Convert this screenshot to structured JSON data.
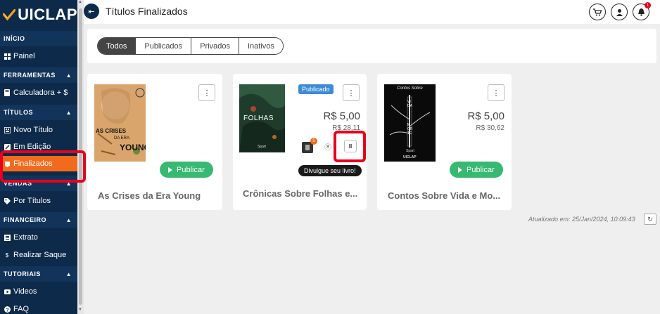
{
  "brand": {
    "name": "UICLAP",
    "colors": {
      "navy": "#0d2a4a",
      "orange": "#f26b1d",
      "green": "#38b972",
      "blue": "#3d8ad6"
    }
  },
  "sidebar": {
    "sections": [
      {
        "label": "INÍCIO",
        "items": [
          {
            "label": "Painel",
            "icon": "grid-icon"
          }
        ]
      },
      {
        "label": "FERRAMENTAS",
        "items": [
          {
            "label": "Calculadora + $",
            "icon": "calculator-icon"
          }
        ]
      },
      {
        "label": "TÍTULOS",
        "items": [
          {
            "label": "Novo Título",
            "icon": "new-doc-icon"
          },
          {
            "label": "Em Edição",
            "icon": "edit-icon"
          },
          {
            "label": "Finalizados",
            "icon": "done-icon",
            "active": true
          }
        ]
      },
      {
        "label": "VENDAS",
        "items": [
          {
            "label": "Por Títulos",
            "icon": "tag-icon"
          }
        ]
      },
      {
        "label": "FINANCEIRO",
        "items": [
          {
            "label": "Extrato",
            "icon": "statement-icon"
          },
          {
            "label": "Realizar Saque",
            "icon": "dollar-icon"
          }
        ]
      },
      {
        "label": "TUTORIAIS",
        "items": [
          {
            "label": "Videos",
            "icon": "video-icon"
          },
          {
            "label": "FAQ",
            "icon": "help-icon"
          }
        ]
      }
    ]
  },
  "header": {
    "title": "Títulos Finalizados",
    "notifications": "1"
  },
  "filters": {
    "tabs": [
      "Todos",
      "Publicados",
      "Privados",
      "Inativos"
    ],
    "active": "Todos"
  },
  "cards": [
    {
      "title": "As Crises da Era Young",
      "cover_text": [
        "AS CRISES",
        "DA ERA",
        "YOUNG"
      ],
      "publish_label": "Publicar"
    },
    {
      "title": "Crônicas Sobre Folhas e...",
      "cover_text": [
        "FOLHAS",
        "Spart"
      ],
      "status": "Publicado",
      "price": "R$ 5,00",
      "price_sub": "R$ 28,11",
      "count_badge": "5",
      "share_label": "Divulgue seu livro!",
      "pause_label": "II"
    },
    {
      "title": "Contos Sobre Vida e Mo...",
      "cover_text": [
        "Contos Sobre",
        "VIDA",
        "MORTE",
        "Spart",
        "UICLAP"
      ],
      "price": "R$ 5,00",
      "price_sub": "R$ 30,62",
      "publish_label": "Publicar"
    }
  ],
  "footer": {
    "updated": "Atualizado em: 25/Jan/2024, 10:09:43"
  }
}
